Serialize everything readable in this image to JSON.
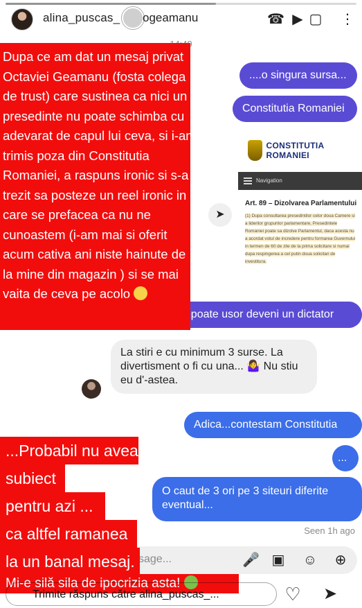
{
  "header": {
    "username": "alina_puscas_",
    "chat_name": "ogeamanu",
    "time": "14:49"
  },
  "messages": {
    "out1": "....o singura sursa...",
    "out2": "Constitutia Romaniei",
    "shared_post": {
      "site_title": "CONSTITUTIA ROMANIEI",
      "nav": "Navigation",
      "article_title": "Art. 89 – Dizolvarea Parlamentului",
      "article_body": "(1) Dupa consultarea presedintilor celor doua Camere si a liderilor grupurilor parlamentare, Presedintele Romaniei poate sa dizolve Parlamentul, daca acesta nu a acordat votul de incredere pentru formarea Guvernului in termen de 60 de zile de la prima solicitare si numai dupa respingerea a cel putin doua solicitari de investitura."
    },
    "out3": "Da...poate usor deveni un dictator",
    "in1": "La stiri e cu minimum 3 surse. La divertisment o fi cu una... 🤷‍♀️ Nu stiu eu d'-astea.",
    "out4": "Adica...contestam Constitutia",
    "out5": "...",
    "out6": "O caut de 3 ori pe 3 siteuri diferite eventual...",
    "seen": "Seen 1h ago"
  },
  "red_text_1": [
    "Dupa ce am dat un mesaj privat",
    "Octaviei  Geamanu (fosta colega",
    "de trust) care sustinea ca nici un",
    "presedinte nu poate schimba cu",
    "adevarat de capul lui ceva, si i-am",
    "trimis poza din Constitutia",
    "Romaniei, a raspuns ironic si s-a",
    "trezit sa posteze un reel  ironic  in",
    "care se prefacea ca nu ne",
    "cunoastem (i-am mai si oferit",
    "acum cativa ani niste hainute de",
    "la mine din magazin ) si se mai",
    "vaita de ceva pe acolo"
  ],
  "red_text_2": [
    "...Probabil nu avea",
    "subiect",
    "pentru azi ...",
    "ca altfel ramanea",
    "la un banal mesaj.",
    "Mi-e silă sila de ipocrizia asta!"
  ],
  "composer": {
    "placeholder": "sage..."
  },
  "reply": {
    "placeholder": "Trimite răspuns către alina_puscas_..."
  }
}
